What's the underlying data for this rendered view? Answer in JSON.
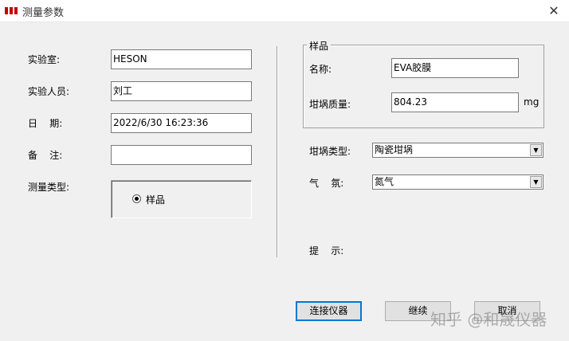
{
  "window": {
    "title": "测量参数",
    "close_glyph": "✕",
    "accent_color": "#c00000"
  },
  "left": {
    "lab_label": "实验室:",
    "lab_value": "HESON",
    "operator_label": "实验人员:",
    "operator_value": "刘工",
    "date_label": "日    期:",
    "date_value": "2022/6/30 16:23:36",
    "note_label": "备    注:",
    "note_value": "",
    "measure_type_label": "测量类型:",
    "measure_type_option": "样品"
  },
  "sample": {
    "group_title": "样品",
    "name_label": "名称:",
    "name_value": "EVA胶膜",
    "crucible_mass_label": "坩埚质量:",
    "crucible_mass_value": "804.23",
    "crucible_mass_unit": "mg"
  },
  "right": {
    "crucible_type_label": "坩埚类型:",
    "crucible_type_value": "陶瓷坩埚",
    "atmosphere_label": "气    氛:",
    "atmosphere_value": "氮气",
    "hint_label": "提    示:"
  },
  "buttons": {
    "connect": "连接仪器",
    "continue": "继续",
    "cancel": "取消"
  },
  "watermark": "知乎 @和晟仪器"
}
